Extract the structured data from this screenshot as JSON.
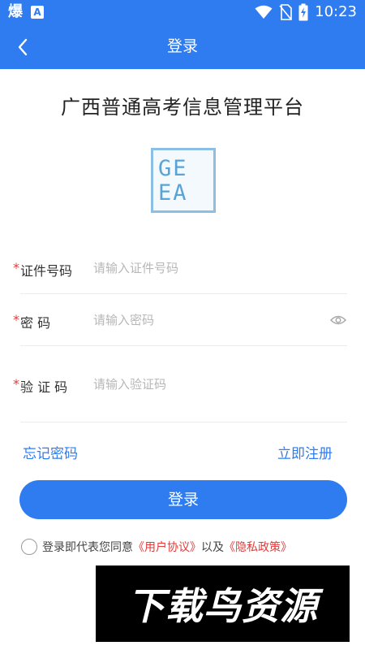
{
  "status_bar": {
    "left_icon": "爆",
    "app_icon_letter": "A",
    "time": "10:23",
    "icons": [
      "wifi-icon",
      "no-sim-icon",
      "battery-charging-icon"
    ]
  },
  "app_bar": {
    "title": "登录",
    "back_icon": "chevron-left-icon"
  },
  "platform_title": "广西普通高考信息管理平台",
  "logo": {
    "line1": "GE",
    "line2": "EA"
  },
  "form": {
    "id": {
      "required_mark": "*",
      "label": "证件号码",
      "placeholder": "请输入证件号码",
      "value": ""
    },
    "password": {
      "required_mark": "*",
      "label": "密 码",
      "placeholder": "请输入密码",
      "value": "",
      "toggle_icon": "eye-icon"
    },
    "captcha": {
      "required_mark": "*",
      "label": "验 证 码",
      "placeholder": "请输入验证码",
      "value": ""
    }
  },
  "links": {
    "forgot": "忘记密码",
    "register": "立即注册"
  },
  "login_button": "登录",
  "agreement": {
    "prefix": "登录即代表您同意",
    "user_agreement": "《用户协议》",
    "conjunction": "以及",
    "privacy_policy": "《隐私政策》",
    "checked": false
  },
  "watermark": "下载鸟资源",
  "colors": {
    "primary": "#2f7cf0",
    "required": "#e23b3b",
    "placeholder": "#b7b7b7"
  }
}
